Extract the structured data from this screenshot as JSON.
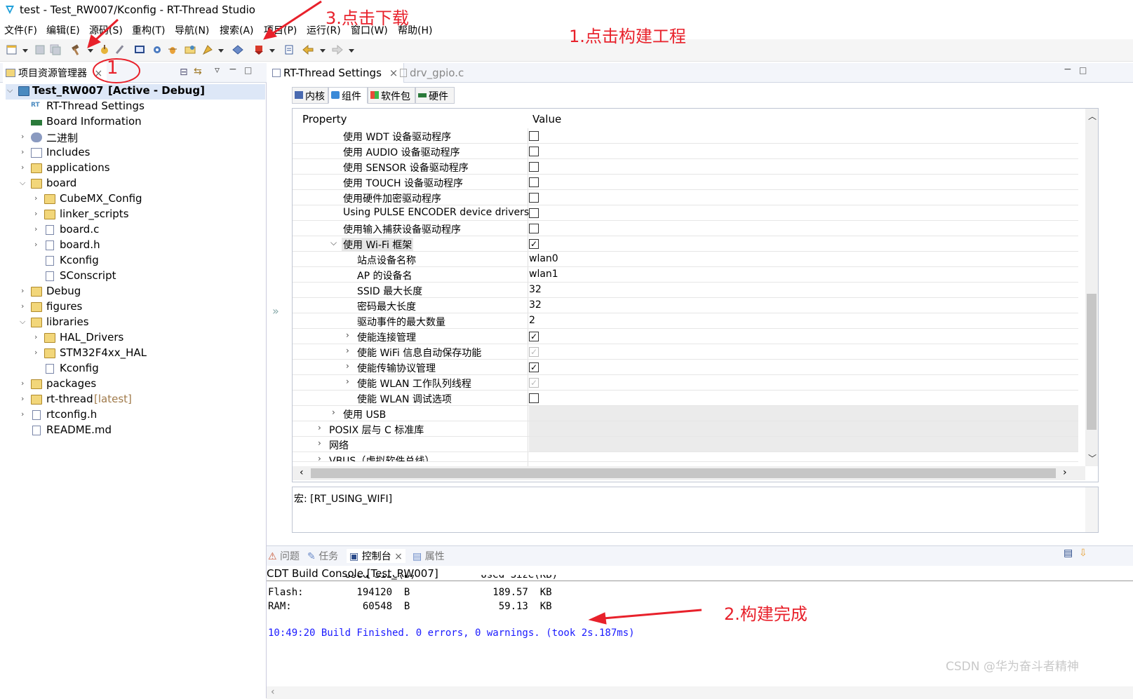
{
  "window": {
    "title": "test - Test_RW007/Kconfig - RT-Thread Studio"
  },
  "menu": [
    "文件(F)",
    "编辑(E)",
    "源码(S)",
    "重构(T)",
    "导航(N)",
    "搜索(A)",
    "项目(P)",
    "运行(R)",
    "窗口(W)",
    "帮助(H)"
  ],
  "explorer": {
    "tab_label": "项目资源管理器",
    "project_name": "Test_RW007",
    "project_config": "[Active - Debug]",
    "items": [
      {
        "label": "RT-Thread Settings"
      },
      {
        "label": "Board Information"
      },
      {
        "label": "二进制"
      },
      {
        "label": "Includes"
      },
      {
        "label": "applications"
      },
      {
        "label": "board"
      },
      {
        "label": "CubeMX_Config"
      },
      {
        "label": "linker_scripts"
      },
      {
        "label": "board.c"
      },
      {
        "label": "board.h"
      },
      {
        "label": "Kconfig"
      },
      {
        "label": "SConscript"
      },
      {
        "label": "Debug"
      },
      {
        "label": "figures"
      },
      {
        "label": "libraries"
      },
      {
        "label": "HAL_Drivers"
      },
      {
        "label": "STM32F4xx_HAL"
      },
      {
        "label": "Kconfig"
      },
      {
        "label": "packages"
      },
      {
        "label": "rt-thread"
      },
      {
        "label": "rtconfig.h"
      },
      {
        "label": "README.md"
      }
    ],
    "rt_thread_tag": "[latest]"
  },
  "editor": {
    "tabs": [
      {
        "label": "RT-Thread Settings"
      },
      {
        "label": "drv_gpio.c"
      }
    ],
    "subtabs": [
      {
        "label": "内核"
      },
      {
        "label": "组件"
      },
      {
        "label": "软件包"
      },
      {
        "label": "硬件"
      }
    ],
    "columns": {
      "property": "Property",
      "value": "Value"
    },
    "rows": [
      {
        "label": "使用 WDT 设备驱动程序",
        "value": "",
        "checked": false
      },
      {
        "label": "使用 AUDIO 设备驱动程序",
        "value": "",
        "checked": false
      },
      {
        "label": "使用 SENSOR 设备驱动程序",
        "value": "",
        "checked": false
      },
      {
        "label": "使用 TOUCH 设备驱动程序",
        "value": "",
        "checked": false
      },
      {
        "label": "使用硬件加密驱动程序",
        "value": "",
        "checked": false
      },
      {
        "label": "Using PULSE ENCODER device drivers",
        "value": "",
        "checked": false
      },
      {
        "label": "使用输入捕获设备驱动程序",
        "value": "",
        "checked": false
      },
      {
        "label": "使用 Wi-Fi 框架",
        "value": "",
        "checked": true
      },
      {
        "label": "站点设备名称",
        "value": "wlan0"
      },
      {
        "label": "AP 的设备名",
        "value": "wlan1"
      },
      {
        "label": "SSID 最大长度",
        "value": "32"
      },
      {
        "label": "密码最大长度",
        "value": "32"
      },
      {
        "label": "驱动事件的最大数量",
        "value": "2"
      },
      {
        "label": "使能连接管理",
        "value": "",
        "checked": true
      },
      {
        "label": "使能 WiFi 信息自动保存功能",
        "value": "",
        "checked": true
      },
      {
        "label": "使能传输协议管理",
        "value": "",
        "checked": true
      },
      {
        "label": "使能 WLAN 工作队列线程",
        "value": "",
        "checked": true
      },
      {
        "label": "使能 WLAN 调试选项",
        "value": "",
        "checked": false
      },
      {
        "label": "使用 USB",
        "value": ""
      },
      {
        "label": "POSIX 层与 C 标准库",
        "value": ""
      },
      {
        "label": "网络",
        "value": ""
      },
      {
        "label": "VBUS（虚拟软件总线）",
        "value": ""
      }
    ],
    "macro_desc": "宏: [RT_USING_WIFI]"
  },
  "console": {
    "tabs": [
      "问题",
      "任务",
      "控制台",
      "属性"
    ],
    "title": "CDT Build Console [Test_RW007]",
    "partial_line": "             Used Size(B)           Used Size(KB)",
    "lines": [
      "Flash:         194120  B              189.57  KB",
      "RAM:            60548  B               59.13  KB"
    ],
    "finished": "10:49:20 Build Finished. 0 errors, 0 warnings. (took 2s.187ms)"
  },
  "annotations": {
    "a1": "1.点击构建工程",
    "a2": "2.构建完成",
    "a3": "3.点击下载",
    "circle_num": "1"
  },
  "watermark": "CSDN @华为奋斗者精神",
  "colors": {
    "annotation": "#e8212b",
    "console_blue": "#1a1aff",
    "tag_gray": "#a07a4a"
  }
}
